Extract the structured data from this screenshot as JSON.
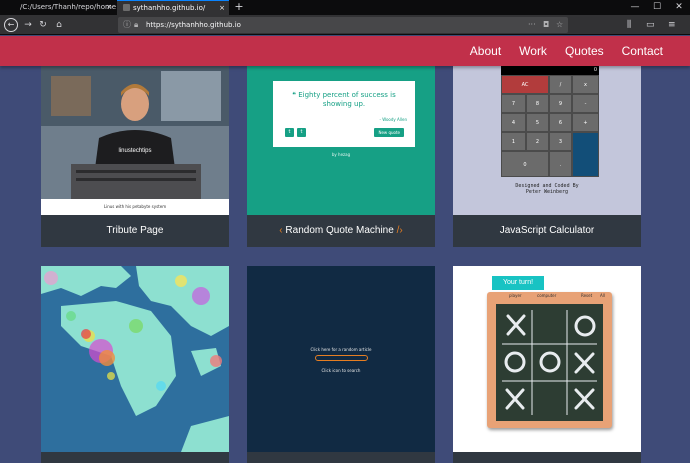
{
  "browser": {
    "tabs": [
      {
        "title": "/C:/Users/Thanh/repo/home/index",
        "close": "×"
      },
      {
        "title": "sythanhho.github.io/",
        "close": "×"
      }
    ],
    "new_tab": "+",
    "window_controls": [
      "—",
      "☐",
      "✕"
    ],
    "url": "https://sythanhho.github.io"
  },
  "site": {
    "nav": [
      "About",
      "Work",
      "Quotes",
      "Contact"
    ],
    "colors": {
      "header": "#c1304a",
      "background": "#3f4b78",
      "caption_bar": "#303841"
    }
  },
  "projects": [
    {
      "caption": "Tribute Page",
      "thumb": {
        "photo_caption": "Linus with his petabyte system"
      }
    },
    {
      "caption_prefix": "‹",
      "caption": "Random Quote Machine",
      "caption_suffix": "/›",
      "thumb": {
        "quote": "Eighty percent of success is showing up.",
        "author": "- Woody Allen",
        "new_quote": "New quote",
        "by": "by hezag"
      }
    },
    {
      "caption": "JavaScript Calculator",
      "thumb": {
        "display": "0",
        "keys": [
          "AC",
          "/",
          "x",
          "7",
          "8",
          "9",
          "-",
          "4",
          "5",
          "6",
          "+",
          "1",
          "2",
          "3",
          "0",
          "."
        ],
        "credit_line1": "Designed and Coded By",
        "credit_line2": "Peter Weinberg"
      }
    },
    {
      "caption": "",
      "thumb": {}
    },
    {
      "caption": "",
      "thumb": {
        "line1": "Click here for a random article",
        "line2": "Click icon to search"
      }
    },
    {
      "caption": "",
      "thumb": {
        "turn": "Your turn!",
        "player": "player",
        "computer": "computer",
        "reset": "Reset",
        "all": "All"
      }
    }
  ]
}
